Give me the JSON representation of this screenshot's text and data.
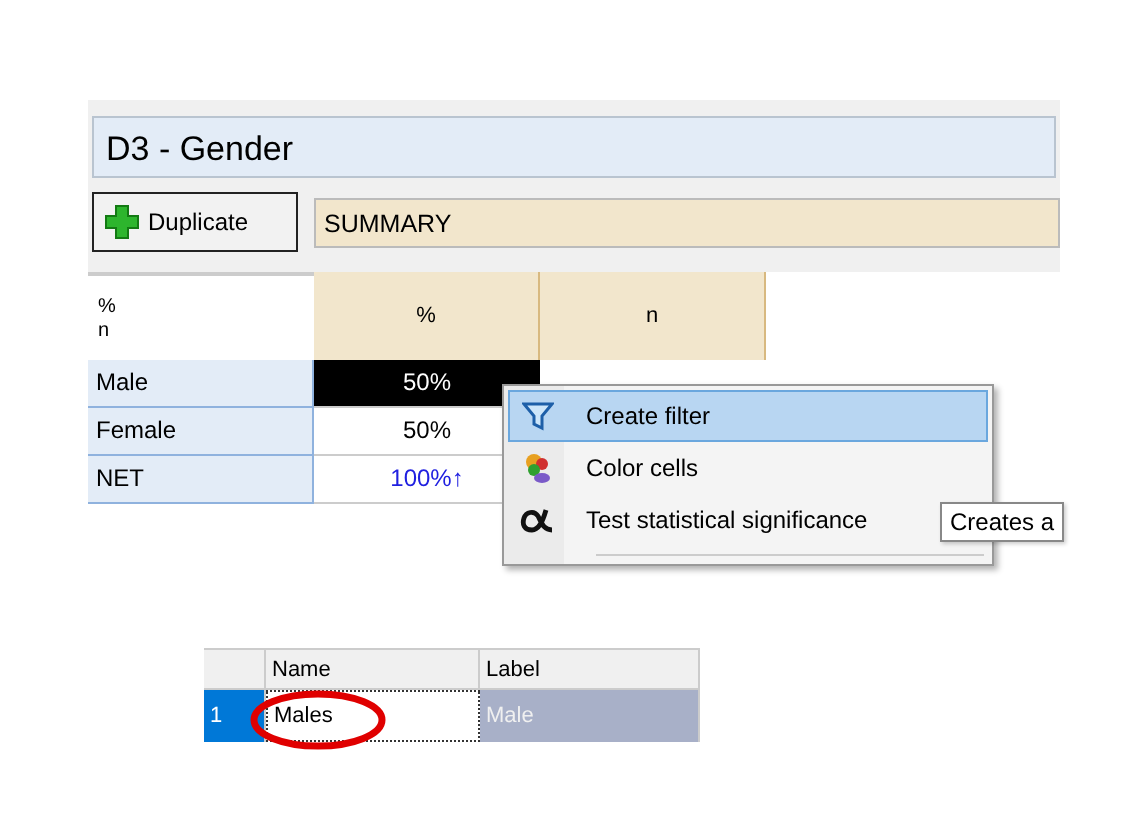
{
  "panel": {
    "title": "D3 - Gender",
    "duplicate_button": "Duplicate",
    "summary": "SUMMARY"
  },
  "table": {
    "corner": [
      "%",
      "n"
    ],
    "columns": [
      "%",
      "n"
    ],
    "rows": [
      {
        "label": "Male",
        "cells": [
          {
            "text": "50%",
            "selected": true,
            "kind": "plain"
          }
        ]
      },
      {
        "label": "Female",
        "cells": [
          {
            "text": "50%",
            "selected": false,
            "kind": "plain"
          }
        ]
      },
      {
        "label": "NET",
        "cells": [
          {
            "text": "100%↑",
            "selected": false,
            "kind": "net"
          }
        ]
      }
    ]
  },
  "context_menu": {
    "items": [
      {
        "label": "Create filter",
        "selected": true,
        "kind": "filter"
      },
      {
        "label": "Color cells",
        "selected": false,
        "kind": "color"
      },
      {
        "label": "Test statistical significance",
        "selected": false,
        "kind": "alpha"
      }
    ]
  },
  "tooltip": "Creates a",
  "grid": {
    "columns": [
      "Name",
      "Label"
    ],
    "row": {
      "index": "1",
      "name": "Males",
      "label": "Male"
    },
    "highlight": true
  }
}
